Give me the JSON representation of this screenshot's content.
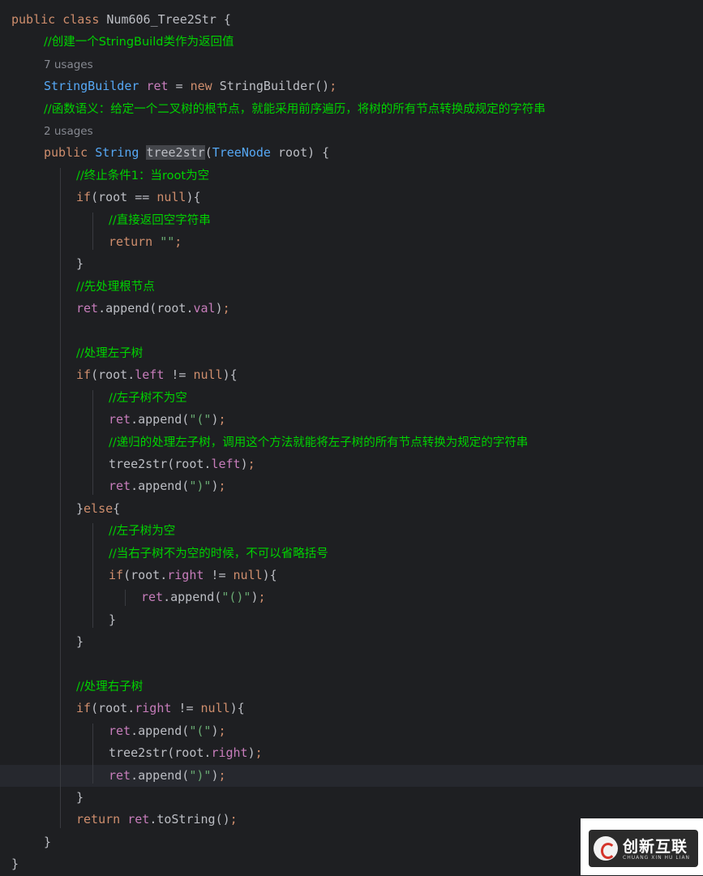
{
  "lines": [
    {
      "tokens": [
        [
          "kw",
          "public class "
        ],
        [
          "classname",
          "Num606_Tree2Str"
        ],
        [
          "plain",
          " {"
        ]
      ]
    },
    {
      "tokens": [
        [
          "cmt",
          "//创建一个StringBuild类作为返回值"
        ]
      ]
    },
    {
      "tokens": [
        [
          "usage",
          "7 usages"
        ]
      ]
    },
    {
      "tokens": [
        [
          "type",
          "StringBuilder "
        ],
        [
          "field",
          "ret"
        ],
        [
          "plain",
          " = "
        ],
        [
          "kw",
          "new "
        ],
        [
          "plain",
          "StringBuilder()"
        ],
        [
          "kw",
          ";"
        ]
      ]
    },
    {
      "tokens": [
        [
          "cmt",
          "//函数语义：给定一个二叉树的根节点，就能采用前序遍历，将树的所有节点转换成规定的字符串"
        ]
      ]
    },
    {
      "tokens": [
        [
          "usage",
          "2 usages"
        ]
      ]
    },
    {
      "tokens": [
        [
          "kw",
          "public "
        ],
        [
          "type",
          "String "
        ],
        [
          "hl",
          "tree2str"
        ],
        [
          "plain",
          "("
        ],
        [
          "type",
          "TreeNode "
        ],
        [
          "plain",
          "root) {"
        ]
      ]
    },
    {
      "tokens": [
        [
          "cmt",
          "//终止条件1：当root为空"
        ]
      ]
    },
    {
      "tokens": [
        [
          "kw",
          "if"
        ],
        [
          "plain",
          "(root == "
        ],
        [
          "kw",
          "null"
        ],
        [
          "plain",
          "){"
        ]
      ]
    },
    {
      "tokens": [
        [
          "cmt",
          "//直接返回空字符串"
        ]
      ]
    },
    {
      "tokens": [
        [
          "kw",
          "return "
        ],
        [
          "str",
          "\"\""
        ],
        [
          "kw",
          ";"
        ]
      ]
    },
    {
      "tokens": [
        [
          "plain",
          "}"
        ]
      ]
    },
    {
      "tokens": [
        [
          "cmt",
          "//先处理根节点"
        ]
      ]
    },
    {
      "tokens": [
        [
          "field",
          "ret"
        ],
        [
          "plain",
          ".append(root."
        ],
        [
          "field",
          "val"
        ],
        [
          "plain",
          ")"
        ],
        [
          "kw",
          ";"
        ]
      ]
    },
    {
      "tokens": []
    },
    {
      "tokens": [
        [
          "cmt",
          "//处理左子树"
        ]
      ]
    },
    {
      "tokens": [
        [
          "kw",
          "if"
        ],
        [
          "plain",
          "(root."
        ],
        [
          "field",
          "left"
        ],
        [
          "plain",
          " != "
        ],
        [
          "kw",
          "null"
        ],
        [
          "plain",
          "){"
        ]
      ]
    },
    {
      "tokens": [
        [
          "cmt",
          "//左子树不为空"
        ]
      ]
    },
    {
      "tokens": [
        [
          "field",
          "ret"
        ],
        [
          "plain",
          ".append("
        ],
        [
          "str",
          "\"(\""
        ],
        [
          "plain",
          ")"
        ],
        [
          "kw",
          ";"
        ]
      ]
    },
    {
      "tokens": [
        [
          "cmt",
          "//递归的处理左子树，调用这个方法就能将左子树的所有节点转换为规定的字符串"
        ]
      ]
    },
    {
      "tokens": [
        [
          "plain",
          "tree2str(root."
        ],
        [
          "field",
          "left"
        ],
        [
          "plain",
          ")"
        ],
        [
          "kw",
          ";"
        ]
      ]
    },
    {
      "tokens": [
        [
          "field",
          "ret"
        ],
        [
          "plain",
          ".append("
        ],
        [
          "str",
          "\")\""
        ],
        [
          "plain",
          ")"
        ],
        [
          "kw",
          ";"
        ]
      ]
    },
    {
      "tokens": [
        [
          "plain",
          "}"
        ],
        [
          "kw",
          "else"
        ],
        [
          "plain",
          "{"
        ]
      ]
    },
    {
      "tokens": [
        [
          "cmt",
          "//左子树为空"
        ]
      ]
    },
    {
      "tokens": [
        [
          "cmt",
          "//当右子树不为空的时候，不可以省略括号"
        ]
      ]
    },
    {
      "tokens": [
        [
          "kw",
          "if"
        ],
        [
          "plain",
          "(root."
        ],
        [
          "field",
          "right"
        ],
        [
          "plain",
          " != "
        ],
        [
          "kw",
          "null"
        ],
        [
          "plain",
          "){"
        ]
      ]
    },
    {
      "tokens": [
        [
          "field",
          "ret"
        ],
        [
          "plain",
          ".append("
        ],
        [
          "str",
          "\"()\""
        ],
        [
          "plain",
          ")"
        ],
        [
          "kw",
          ";"
        ]
      ]
    },
    {
      "tokens": [
        [
          "plain",
          "}"
        ]
      ]
    },
    {
      "tokens": [
        [
          "plain",
          "}"
        ]
      ]
    },
    {
      "tokens": []
    },
    {
      "tokens": [
        [
          "cmt",
          "//处理右子树"
        ]
      ]
    },
    {
      "tokens": [
        [
          "kw",
          "if"
        ],
        [
          "plain",
          "(root."
        ],
        [
          "field",
          "right"
        ],
        [
          "plain",
          " != "
        ],
        [
          "kw",
          "null"
        ],
        [
          "plain",
          "){"
        ]
      ]
    },
    {
      "tokens": [
        [
          "field",
          "ret"
        ],
        [
          "plain",
          ".append("
        ],
        [
          "str",
          "\"(\""
        ],
        [
          "plain",
          ")"
        ],
        [
          "kw",
          ";"
        ]
      ]
    },
    {
      "tokens": [
        [
          "plain",
          "tree2str(root."
        ],
        [
          "field",
          "right"
        ],
        [
          "plain",
          ")"
        ],
        [
          "kw",
          ";"
        ]
      ]
    },
    {
      "tokens": [
        [
          "field",
          "ret"
        ],
        [
          "plain",
          ".append("
        ],
        [
          "str",
          "\")\""
        ],
        [
          "plain",
          ")"
        ],
        [
          "kw",
          ";"
        ]
      ]
    },
    {
      "tokens": [
        [
          "plain",
          "}"
        ]
      ]
    },
    {
      "tokens": [
        [
          "kw",
          "return "
        ],
        [
          "field",
          "ret"
        ],
        [
          "plain",
          ".toString()"
        ],
        [
          "kw",
          ";"
        ]
      ]
    },
    {
      "tokens": [
        [
          "plain",
          "}"
        ]
      ]
    },
    {
      "tokens": [
        [
          "plain",
          "}"
        ]
      ]
    }
  ],
  "watermark": {
    "brand": "创新互联",
    "subtitle": "CHUANG XIN HU LIAN"
  }
}
